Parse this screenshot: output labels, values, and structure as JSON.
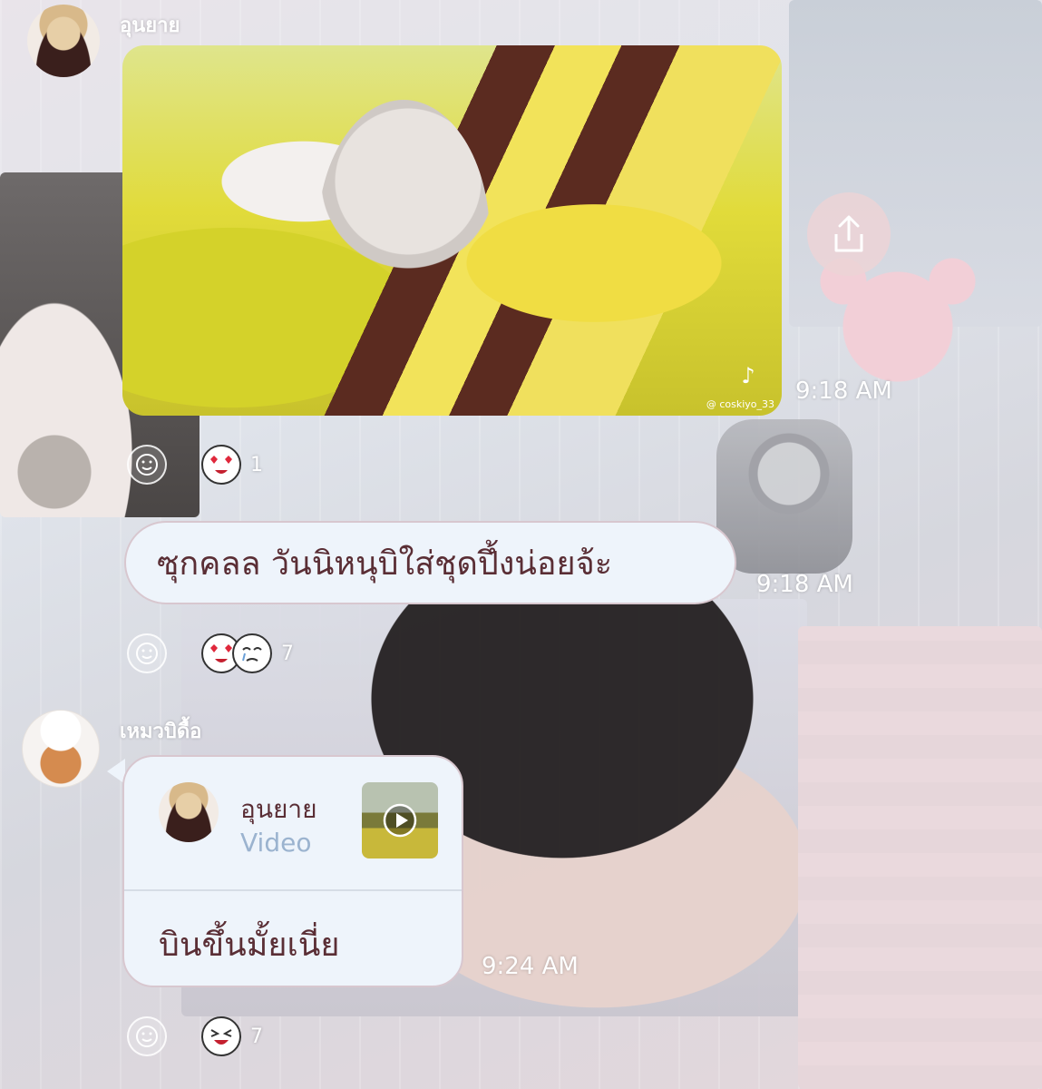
{
  "messages": [
    {
      "sender": "อุนยาย",
      "type": "video",
      "video_watermark": "@ coskiyo_33",
      "video_brand": "TikTok",
      "time": "9:18 AM",
      "reaction_count": "1"
    },
    {
      "text": "ซุกคลล วันนิหนุบิใส่ชุดปึ้งน่อยจ้ะ",
      "time": "9:18 AM",
      "reaction_count": "7"
    },
    {
      "sender": "เหมวบิดื้อ",
      "reply_to": {
        "name": "อุนยาย",
        "type": "Video"
      },
      "text": "บินขึ้นมั้ยเนี่ย",
      "time": "9:24 AM",
      "reaction_count": "7"
    }
  ],
  "icons": {
    "share": "share-icon",
    "add_reaction": "smiley-icon",
    "play": "play-icon"
  },
  "colors": {
    "bubble_bg": "#eef4fb",
    "bubble_text": "#5a2e35",
    "reply_type": "#9bb3cf"
  }
}
